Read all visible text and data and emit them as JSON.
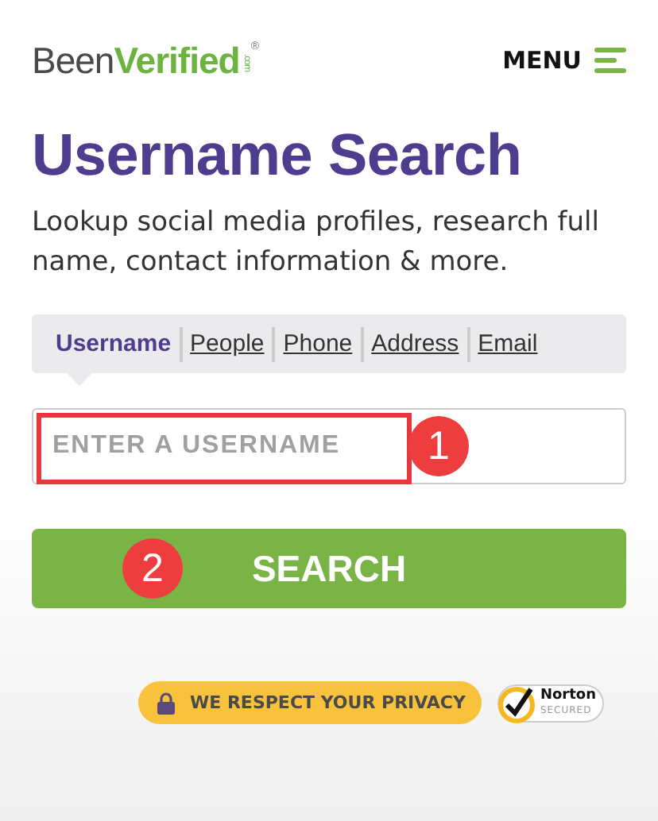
{
  "header": {
    "logo": {
      "first": "Been",
      "second": "Verified",
      "suffix": ".com",
      "mark": "®"
    },
    "menu": {
      "label": "MENU"
    }
  },
  "title": "Username Search",
  "description": "Lookup social media profiles, research full name, contact information & more.",
  "tabs": [
    {
      "label": "Username",
      "selected": true
    },
    {
      "label": "People",
      "selected": false
    },
    {
      "label": "Phone",
      "selected": false
    },
    {
      "label": "Address",
      "selected": false
    },
    {
      "label": "Email",
      "selected": false
    }
  ],
  "search_field": {
    "placeholder": "ENTER A USERNAME"
  },
  "search_button": {
    "label": "SEARCH"
  },
  "annotations": [
    {
      "label": "1"
    },
    {
      "label": "2"
    }
  ],
  "privacy_badge": {
    "label": "WE RESPECT YOUR PRIVACY"
  },
  "norton_badge": {
    "name": "Norton",
    "caption": "SECURED"
  }
}
